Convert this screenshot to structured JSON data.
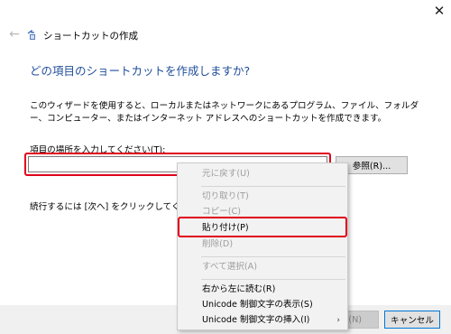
{
  "window": {
    "title": "ショートカットの作成",
    "close_glyph": "✕",
    "back_glyph": "←"
  },
  "main": {
    "heading": "どの項目のショートカットを作成しますか?",
    "description": "このウィザードを使用すると、ローカルまたはネットワークにあるプログラム、ファイル、フォルダー、コンピューター、またはインターネット アドレスへのショートカットを作成できます。",
    "field_label": "項目の場所を入力してください(T):",
    "field_value": "",
    "browse_label": "参照(R)...",
    "continue_text": "続行するには [次へ] をクリックしてください。"
  },
  "footer": {
    "next_label": "(N)",
    "cancel_label": "キャンセル"
  },
  "context_menu": {
    "undo": "元に戻す(U)",
    "cut": "切り取り(T)",
    "copy": "コピー(C)",
    "paste": "貼り付け(P)",
    "delete": "削除(D)",
    "select_all": "すべて選択(A)",
    "rtl": "右から左に読む(R)",
    "show_unicode": "Unicode 制御文字の表示(S)",
    "insert_unicode": "Unicode 制御文字の挿入(I)",
    "submenu_arrow": "›"
  },
  "colors": {
    "heading": "#1f4e9a",
    "highlight": "#e0001b",
    "disabled_text": "#9d9d9d",
    "cancel_border": "#0078d7"
  }
}
